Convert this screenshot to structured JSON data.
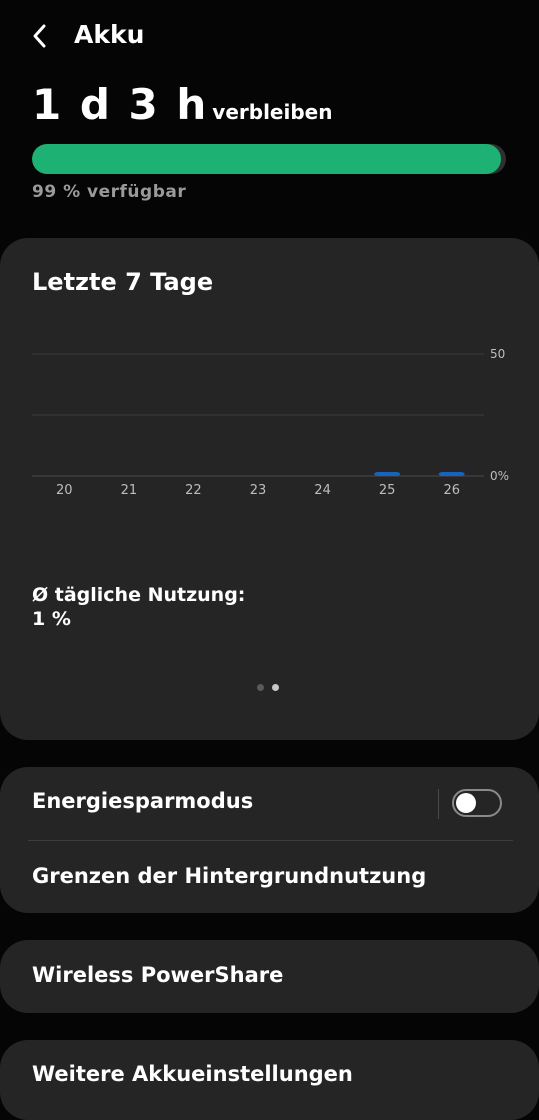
{
  "header": {
    "title": "Akku",
    "back_icon": "chevron-left-icon"
  },
  "battery": {
    "remaining_value": "1 d 3 h",
    "remaining_suffix": "verbleiben",
    "percent": 99,
    "available_text": "99 % verfügbar",
    "bar_color": "#1db173"
  },
  "usage_card": {
    "title": "Letzte 7 Tage",
    "avg_label": "Ø tägliche Nutzung:",
    "avg_value": "1 %",
    "page_dots": 2,
    "active_dot": 1
  },
  "chart_data": {
    "type": "bar",
    "categories": [
      "20",
      "21",
      "22",
      "23",
      "24",
      "25",
      "26"
    ],
    "values": [
      0,
      0,
      0,
      0,
      0,
      1.5,
      0.5
    ],
    "y_ticks": [
      "50",
      "0%"
    ],
    "ylim": [
      0,
      50
    ],
    "bar_color": "#1565c0"
  },
  "settings": {
    "power_saving": {
      "label": "Energiesparmodus",
      "enabled": false
    },
    "background_limits": {
      "label": "Grenzen der Hintergrundnutzung"
    },
    "wireless_powershare": {
      "label": "Wireless PowerShare"
    },
    "more_settings": {
      "label": "Weitere Akkueinstellungen"
    }
  }
}
